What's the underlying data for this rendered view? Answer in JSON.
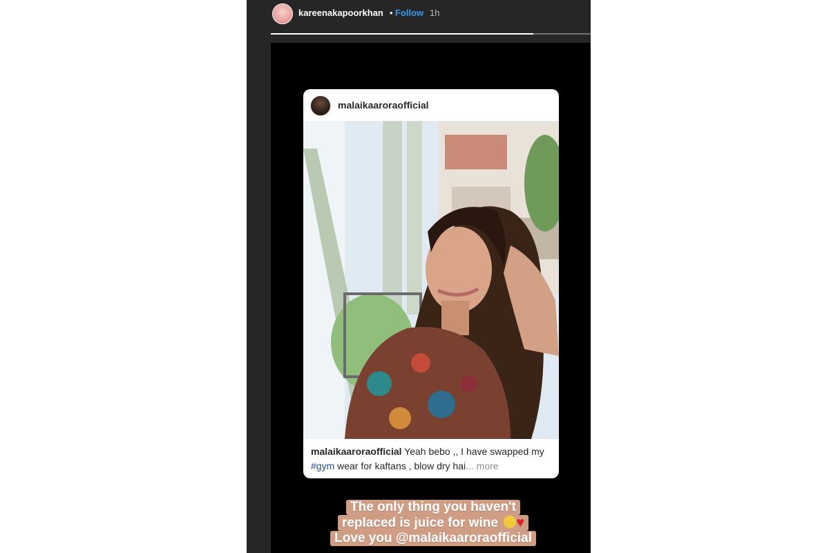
{
  "story_header": {
    "username": "kareenakapoorkhan",
    "separator": "•",
    "follow_label": "Follow",
    "time": "1h",
    "progress": 0.82
  },
  "shared_post": {
    "username": "malaikaaroraofficial",
    "caption": {
      "username": "malaikaaroraofficial",
      "text_start": "Yeah bebo ,, I have swapped my",
      "hashtag": "#gym",
      "text_end": "wear for kaftans , blow dry hai",
      "ellipsis": "...",
      "more": "more"
    }
  },
  "sticker": {
    "line1": "The only thing you haven't",
    "line2": "replaced is juice for wine",
    "line3": "Love you @malaikaaroraofficial"
  },
  "colors": {
    "follow": "#3897f0",
    "hashtag": "#1e4f8a",
    "sticker_bg": "#cf9c84",
    "story_bg": "#262626"
  },
  "icons": {
    "avatar": "profile-photo",
    "emoji1": "hand-over-mouth-emoji",
    "emoji2": "red-heart-emoji"
  }
}
